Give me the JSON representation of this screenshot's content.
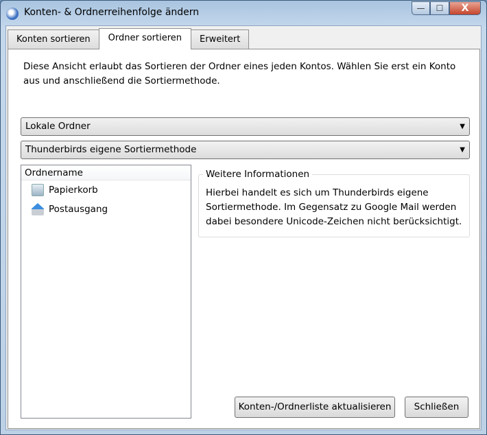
{
  "window": {
    "title": "Konten- & Ordnerreihenfolge ändern",
    "minimize": "—",
    "maximize": "☐",
    "close": "X"
  },
  "tabs": [
    {
      "label": "Konten sortieren"
    },
    {
      "label": "Ordner sortieren"
    },
    {
      "label": "Erweitert"
    }
  ],
  "description": "Diese Ansicht erlaubt das Sortieren der Ordner eines jeden Kontos. Wählen Sie erst ein Konto aus und anschließend die Sortiermethode.",
  "account_select": {
    "value": "Lokale Ordner"
  },
  "method_select": {
    "value": "Thunderbirds eigene Sortiermethode"
  },
  "dropdown_arrow": "▼",
  "tree": {
    "header": "Ordnername",
    "items": [
      {
        "label": "Papierkorb",
        "icon": "trash-icon"
      },
      {
        "label": "Postausgang",
        "icon": "outbox-icon"
      }
    ]
  },
  "info": {
    "legend": "Weitere Informationen",
    "text": "Hierbei handelt es sich um Thunderbirds eigene Sortiermethode. Im Gegensatz zu Google Mail werden dabei besondere Unicode-Zeichen nicht berücksichtigt."
  },
  "buttons": {
    "refresh": "Konten-/Ordnerliste aktualisieren",
    "close": "Schließen"
  }
}
